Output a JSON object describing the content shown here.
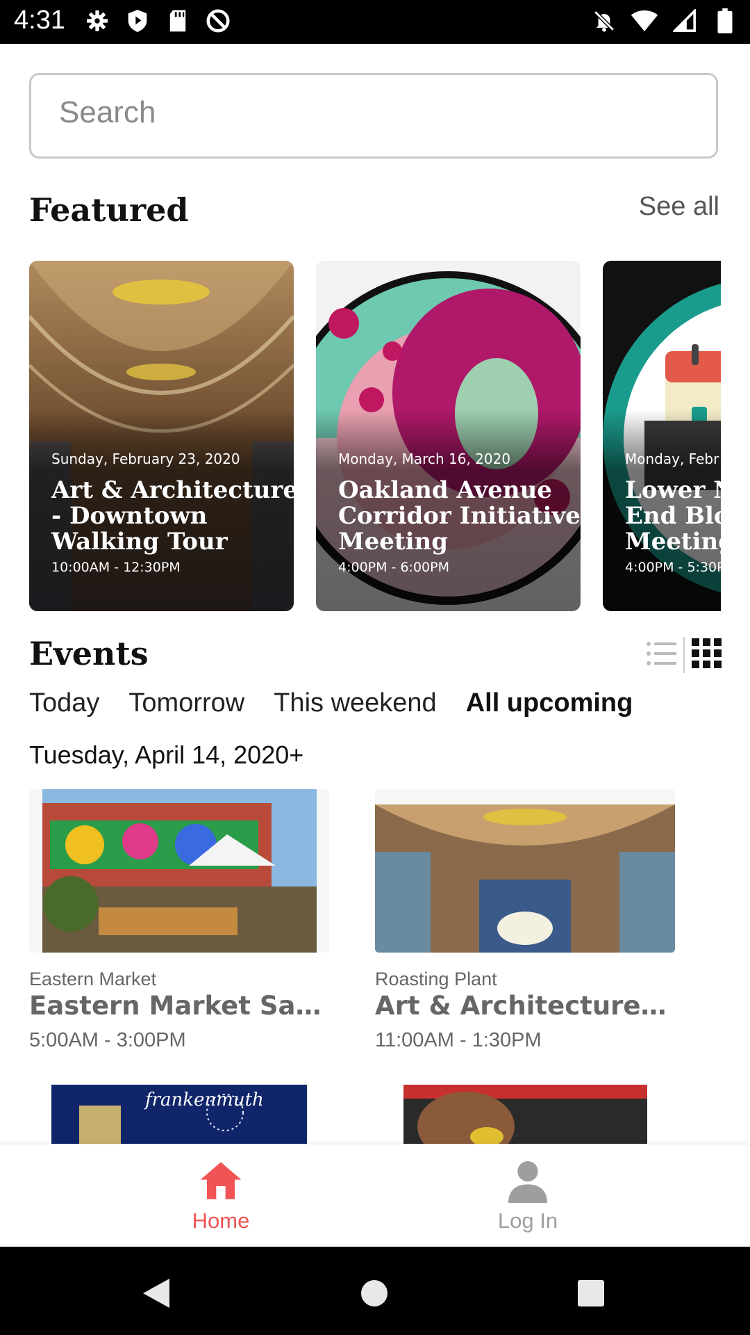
{
  "status_bar": {
    "time": "4:31",
    "left_icons": [
      "gear-icon",
      "shield-play-icon",
      "sd-card-icon",
      "at-sign-icon"
    ],
    "right_icons": [
      "bell-off-icon",
      "wifi-icon",
      "signal-icon",
      "battery-icon"
    ]
  },
  "search": {
    "placeholder": "Search"
  },
  "featured": {
    "title": "Featured",
    "see_all": "See all",
    "cards": [
      {
        "date": "Sunday, February 23, 2020",
        "title_lines": [
          "Art & Architecture",
          "- Downtown",
          "Walking Tour"
        ],
        "time": "10:00AM - 12:30PM"
      },
      {
        "date": "Monday, March 16, 2020",
        "title_lines": [
          "Oakland Avenue",
          "Corridor Initiative",
          "Meeting"
        ],
        "time": "4:00PM - 6:00PM"
      },
      {
        "date": "Monday, Febr",
        "title_lines": [
          "Lower N",
          "End Bloc",
          "Meeting"
        ],
        "time": "4:00PM - 5:30P"
      }
    ]
  },
  "events": {
    "title": "Events",
    "view_icons": [
      "list-view-icon",
      "grid-view-icon"
    ],
    "tabs": [
      "Today",
      "Tomorrow",
      "This weekend",
      "All upcoming"
    ],
    "active_tab": "All upcoming",
    "date_heading": "Tuesday, April 14, 2020+",
    "cards": [
      {
        "venue": "Eastern Market",
        "title": "Eastern Market Satur...",
        "time": "5:00AM - 3:00PM"
      },
      {
        "venue": "Roasting Plant",
        "title": "Art & Architecture - ...",
        "time": "11:00AM - 1:30PM"
      }
    ],
    "partial_thumbs": [
      "frankenmuth"
    ]
  },
  "bottom_nav": {
    "items": [
      {
        "label": "Home",
        "icon": "home-icon",
        "active": true
      },
      {
        "label": "Log In",
        "icon": "person-icon",
        "active": false
      }
    ],
    "active_color": "#f05454",
    "inactive_color": "#9e9e9e"
  },
  "system_nav": {
    "icons": [
      "back-icon",
      "home-circle-icon",
      "recents-icon"
    ]
  }
}
